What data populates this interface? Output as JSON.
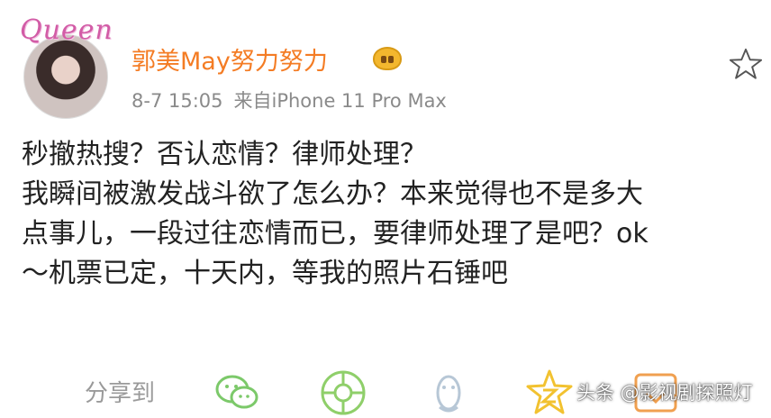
{
  "profile": {
    "avatar_logo": "Queen",
    "username": "郭美May努力努力",
    "badge_icon": "vip-badge-icon",
    "timestamp": "8-7 15:05",
    "source": "来自iPhone 11 Pro Max"
  },
  "post": {
    "lines": [
      "秒撤热搜？否认恋情？律师处理？",
      "我瞬间被激发战斗欲了怎么办？本来觉得也不是多大",
      "点事儿，一段过往恋情而已，要律师处理了是吧？ok",
      "～机票已定，十天内，等我的照片石锤吧"
    ]
  },
  "share": {
    "label": "分享到",
    "targets": [
      "wechat-icon",
      "moments-icon",
      "qq-icon",
      "qzone-icon",
      "more-share-icon"
    ]
  },
  "watermark": "头条 @影视剧探照灯",
  "colors": {
    "username": "#f47c24",
    "meta": "#8a8a8a",
    "share_icon_green": "#7cc96a",
    "share_icon_yellow": "#f2c230"
  }
}
